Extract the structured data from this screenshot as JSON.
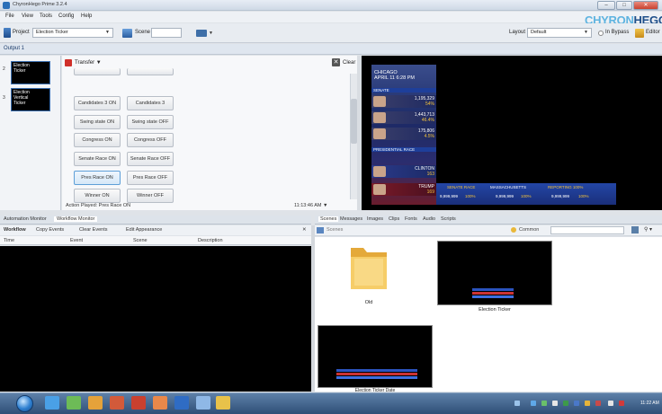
{
  "window": {
    "title": "ChyronHego Prime 3.2.4",
    "minimize_label": "–",
    "maximize_label": "□",
    "close_label": "✕"
  },
  "menu": {
    "items": [
      "File",
      "View",
      "Tools",
      "Config",
      "Help"
    ],
    "brand_part1": "CHYRON",
    "brand_part2": "HEGO"
  },
  "toolbar": {
    "project_label": "Project",
    "project_value": "Election Ticker",
    "scene_label": "Scene",
    "layout_label": "Layout",
    "layout_value": "Default",
    "bypass_label": "In Bypass",
    "editor_label": "Editor"
  },
  "output": {
    "tab_label": "Output 1"
  },
  "scene_list": [
    {
      "num": "2",
      "lines": [
        "Election",
        "Ticker"
      ]
    },
    {
      "num": "3",
      "lines": [
        "Election",
        "Vertical",
        "Ticker"
      ]
    }
  ],
  "button_panel": {
    "transfer_label": "Transfer",
    "clear_label": "Clear",
    "buttons": [
      {
        "label": "Candidates 3 ON",
        "hl": false
      },
      {
        "label": "Candidates 3",
        "hl": false
      },
      {
        "label": "Swing state ON",
        "hl": false
      },
      {
        "label": "Swing state OFF",
        "hl": false
      },
      {
        "label": "Congress ON",
        "hl": false
      },
      {
        "label": "Congress OFF",
        "hl": false
      },
      {
        "label": "Senate Race ON",
        "hl": false
      },
      {
        "label": "Senate Race OFF",
        "hl": false
      },
      {
        "label": "Pres Race ON",
        "hl": true
      },
      {
        "label": "Pres Race OFF",
        "hl": false
      },
      {
        "label": "Winner ON",
        "hl": false
      },
      {
        "label": "Winner OFF",
        "hl": false
      }
    ],
    "action_played": "Action Played: Pres Race ON",
    "clock": "11:13:46 AM"
  },
  "preview": {
    "header_line1": "CHICAGO",
    "header_line2": "APRIL 11  6:28 PM",
    "title_strip": "SENATE",
    "rows": [
      {
        "value": "1,195,329",
        "pct": "54%"
      },
      {
        "value": "1,443,713",
        "pct": "46.4%"
      },
      {
        "value": "175,806",
        "pct": "4.5%"
      }
    ],
    "section_strip": "PRESIDENTIAL RACE",
    "bottom_name": "CLINTON",
    "bottom_value": "163",
    "bottom_name2": "TRUMP",
    "bottom_value2": "169",
    "ticker_race": "SENATE RACE",
    "ticker_state": "MASSACHUSETTS",
    "ticker_reporting": "REPORTING 100%",
    "ticker_votes": [
      "9,999,999",
      "9,999,999",
      "9,999,999"
    ],
    "ticker_pcts": [
      "100%",
      "100%",
      "100%"
    ]
  },
  "automation": {
    "tabs": [
      "Automation Monitor",
      "Workflow Monitor"
    ],
    "toolbar_items": [
      "Workflow",
      "Copy Events",
      "Clear Events",
      "Edit Appearance"
    ],
    "columns": [
      "Time",
      "Event",
      "Scene",
      "Description"
    ]
  },
  "scenes_panel": {
    "tabs": [
      "Scenes",
      "Messages",
      "Images",
      "Clips",
      "Fonts",
      "Audio",
      "Scripts"
    ],
    "search_placeholder": "Scenes",
    "common_label": "Common",
    "items": [
      {
        "label": "Old",
        "kind": "folder"
      },
      {
        "label": "Election Ticker",
        "kind": "thumb"
      },
      {
        "label": "Election Ticker Date",
        "kind": "thumb"
      }
    ]
  },
  "taskbar": {
    "time": "11:22 AM"
  }
}
